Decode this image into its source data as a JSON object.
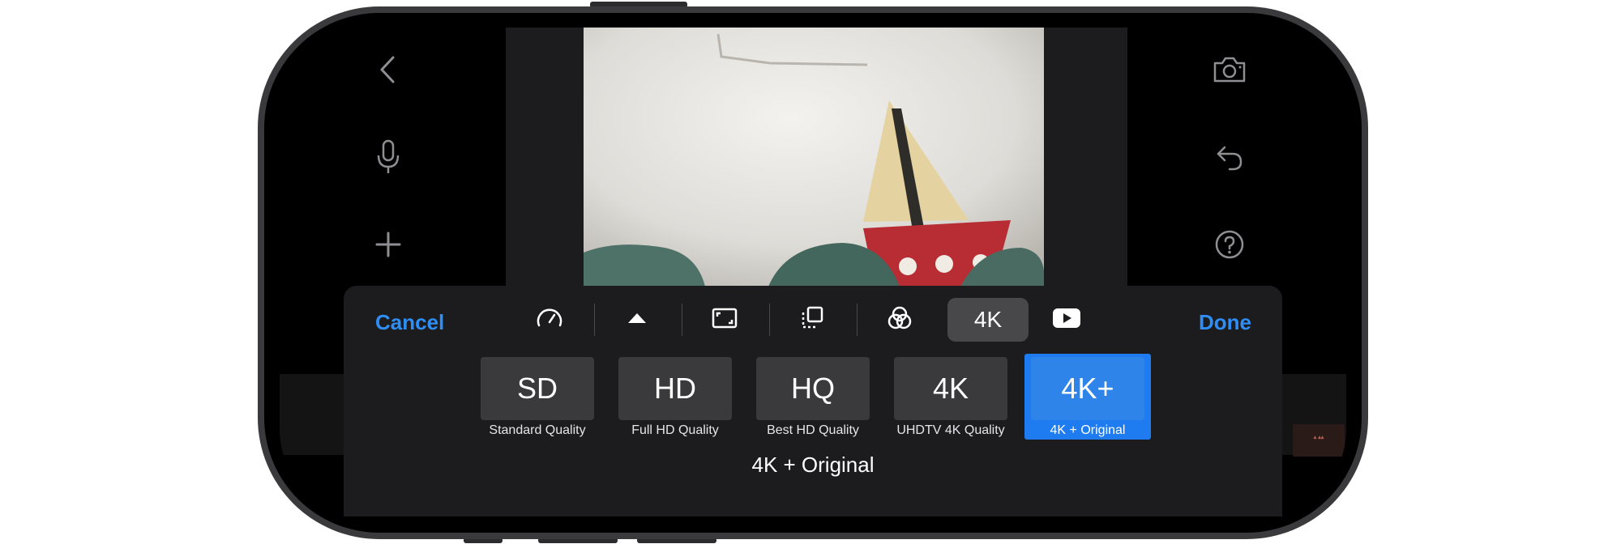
{
  "toolbar": {
    "cancel_label": "Cancel",
    "done_label": "Done",
    "active_tool_label": "4K",
    "tools": [
      "speed-icon",
      "triangle-up-icon",
      "aspect-icon",
      "crop-icon",
      "filters-icon",
      "4k",
      "youtube-icon"
    ]
  },
  "quality": {
    "options": [
      {
        "label": "SD",
        "caption": "Standard Quality"
      },
      {
        "label": "HD",
        "caption": "Full HD Quality"
      },
      {
        "label": "HQ",
        "caption": "Best HD Quality"
      },
      {
        "label": "4K",
        "caption": "UHDTV 4K Quality"
      },
      {
        "label": "4K+",
        "caption": "4K + Original"
      }
    ],
    "selected_description": "4K + Original"
  },
  "colors": {
    "accent": "#2e8ef5",
    "selected": "#1e7cf0"
  }
}
